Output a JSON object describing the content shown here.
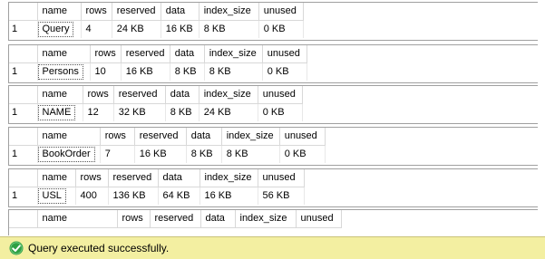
{
  "results": [
    {
      "columns": [
        "name",
        "rows",
        "reserved",
        "data",
        "index_size",
        "unused"
      ],
      "rows": [
        {
          "rownum": "1",
          "values": [
            "Query",
            "4",
            "24 KB",
            "16 KB",
            "8 KB",
            "0 KB"
          ]
        }
      ]
    },
    {
      "columns": [
        "name",
        "rows",
        "reserved",
        "data",
        "index_size",
        "unused"
      ],
      "rows": [
        {
          "rownum": "1",
          "values": [
            "Persons",
            "10",
            "16 KB",
            "8 KB",
            "8 KB",
            "0 KB"
          ]
        }
      ]
    },
    {
      "columns": [
        "name",
        "rows",
        "reserved",
        "data",
        "index_size",
        "unused"
      ],
      "rows": [
        {
          "rownum": "1",
          "values": [
            "NAME",
            "12",
            "32 KB",
            "8 KB",
            "24 KB",
            "0 KB"
          ]
        }
      ]
    },
    {
      "columns": [
        "name",
        "rows",
        "reserved",
        "data",
        "index_size",
        "unused"
      ],
      "rows": [
        {
          "rownum": "1",
          "values": [
            "BookOrder",
            "7",
            "16 KB",
            "8 KB",
            "8 KB",
            "0 KB"
          ]
        }
      ]
    },
    {
      "columns": [
        "name",
        "rows",
        "reserved",
        "data",
        "index_size",
        "unused"
      ],
      "rows": [
        {
          "rownum": "1",
          "values": [
            "USL",
            "400",
            "136 KB",
            "64 KB",
            "16 KB",
            "56 KB"
          ]
        }
      ]
    },
    {
      "columns": [
        "name",
        "rows",
        "reserved",
        "data",
        "index_size",
        "unused"
      ],
      "rows": []
    }
  ],
  "status": {
    "message": "Query executed successfully.",
    "icon": "success-check-icon",
    "icon_color": "#2ea043",
    "background": "#f3efa1"
  }
}
